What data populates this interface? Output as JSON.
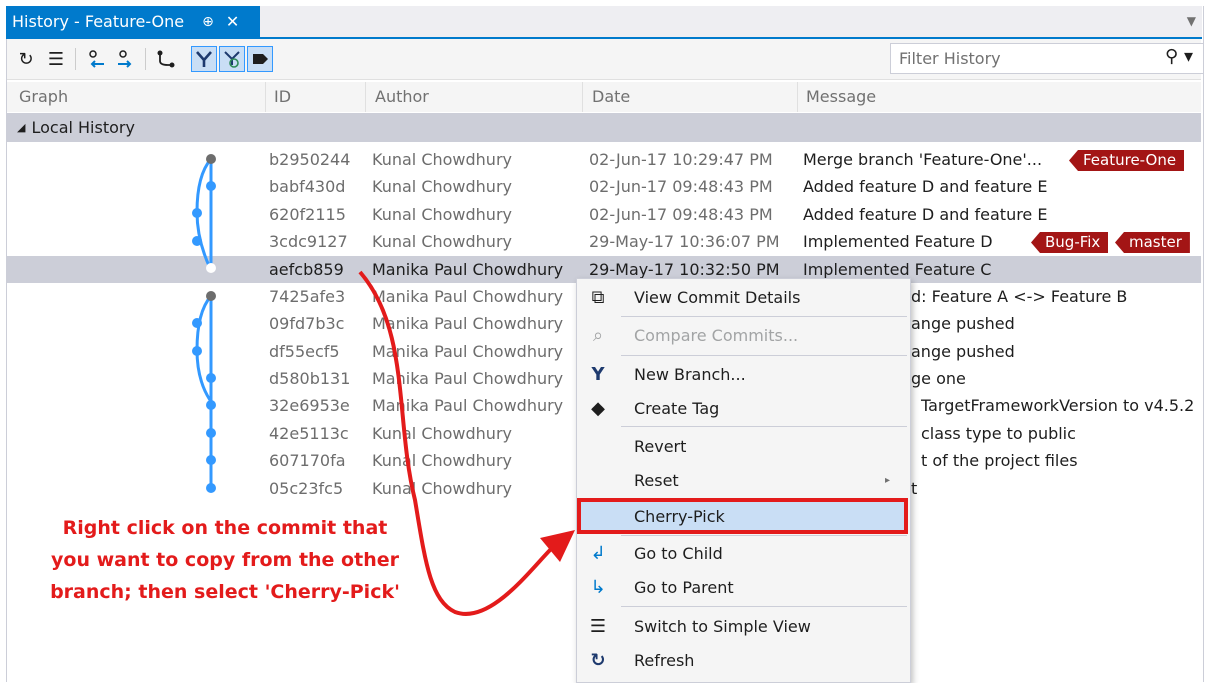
{
  "tab": {
    "title": "History - Feature-One",
    "pin_glyph": "⊕",
    "close_glyph": "✕"
  },
  "toolbar": {
    "filter_placeholder": "Filter History",
    "icons": [
      "refresh-icon",
      "simple-view-icon",
      "go-to-child-icon",
      "go-to-parent-icon",
      "graph-icon",
      "show-branches-icon",
      "remote-branches-icon",
      "tags-icon"
    ]
  },
  "columns": {
    "graph": "Graph",
    "id": "ID",
    "author": "Author",
    "date": "Date",
    "message": "Message"
  },
  "group": {
    "label": "Local History",
    "arrow": "◢"
  },
  "rows": [
    {
      "id": "b2950244",
      "author": "Kunal Chowdhury",
      "date": "02-Jun-17 10:29:47 PM",
      "message": "Merge branch 'Feature-One'..."
    },
    {
      "id": "babf430d",
      "author": "Kunal Chowdhury",
      "date": "02-Jun-17 09:48:43 PM",
      "message": "Added feature D and feature E"
    },
    {
      "id": "620f2115",
      "author": "Kunal Chowdhury",
      "date": "02-Jun-17 09:48:43 PM",
      "message": "Added feature D and feature E"
    },
    {
      "id": "3cdc9127",
      "author": "Kunal Chowdhury",
      "date": "29-May-17 10:36:07 PM",
      "message": "Implemented Feature D"
    },
    {
      "id": "aefcb859",
      "author": "Manika Paul Chowdhury",
      "date": "29-May-17 10:32:50 PM",
      "message": "Implemented Feature C"
    },
    {
      "id": "7425afe3",
      "author": "Manika Paul Chowdhury",
      "date": "",
      "message": "d: Feature A <-> Feature B"
    },
    {
      "id": "09fd7b3c",
      "author": "Manika Paul Chowdhury",
      "date": "",
      "message": "ange pushed"
    },
    {
      "id": "df55ecf5",
      "author": "Manika Paul Chowdhury",
      "date": "",
      "message": "ange pushed"
    },
    {
      "id": "d580b131",
      "author": "Manika Paul Chowdhury",
      "date": "",
      "message": "ge one"
    },
    {
      "id": "32e6953e",
      "author": "Manika Paul Chowdhury",
      "date": "",
      "message": "TargetFrameworkVersion to v4.5.2"
    },
    {
      "id": "42e5113c",
      "author": "Kunal Chowdhury",
      "date": "",
      "message": "class type to public"
    },
    {
      "id": "607170fa",
      "author": "Kunal Chowdhury",
      "date": "",
      "message": "t of the project files"
    },
    {
      "id": "05c23fc5",
      "author": "Kunal Chowdhury",
      "date": "",
      "message": "t"
    }
  ],
  "tags": {
    "feature_one": "Feature-One",
    "bug_fix": "Bug-Fix",
    "master": "master"
  },
  "menu": {
    "items": [
      {
        "label": "View Commit Details",
        "icon": "commit-details-icon",
        "glyph": "⧉"
      },
      {
        "label": "Compare Commits...",
        "icon": "compare-icon",
        "glyph": "⌕",
        "disabled": true
      },
      {
        "label": "New Branch...",
        "icon": "branch-icon",
        "glyph": "Y"
      },
      {
        "label": "Create Tag",
        "icon": "tag-icon",
        "glyph": "◆"
      },
      {
        "label": "Revert",
        "icon": "",
        "glyph": ""
      },
      {
        "label": "Reset",
        "icon": "",
        "glyph": "",
        "submenu": true
      },
      {
        "label": "Cherry-Pick",
        "icon": "",
        "glyph": ""
      },
      {
        "label": "Go to Child",
        "icon": "go-to-child-icon",
        "glyph": "↲"
      },
      {
        "label": "Go to Parent",
        "icon": "go-to-parent-icon",
        "glyph": "↳"
      },
      {
        "label": "Switch to Simple View",
        "icon": "simple-view-icon",
        "glyph": "☰"
      },
      {
        "label": "Refresh",
        "icon": "refresh-icon",
        "glyph": "↻"
      }
    ],
    "submenu_arrow": "▸"
  },
  "annotation": {
    "text": "Right click on the commit that you want to copy from the other branch; then select 'Cherry-Pick'"
  },
  "colors": {
    "accent": "#007acc",
    "selection": "#ccced8",
    "highlight": "#c9def5",
    "tag": "#a31515",
    "annotation": "#e31b1b",
    "graph": "#3399ff"
  }
}
